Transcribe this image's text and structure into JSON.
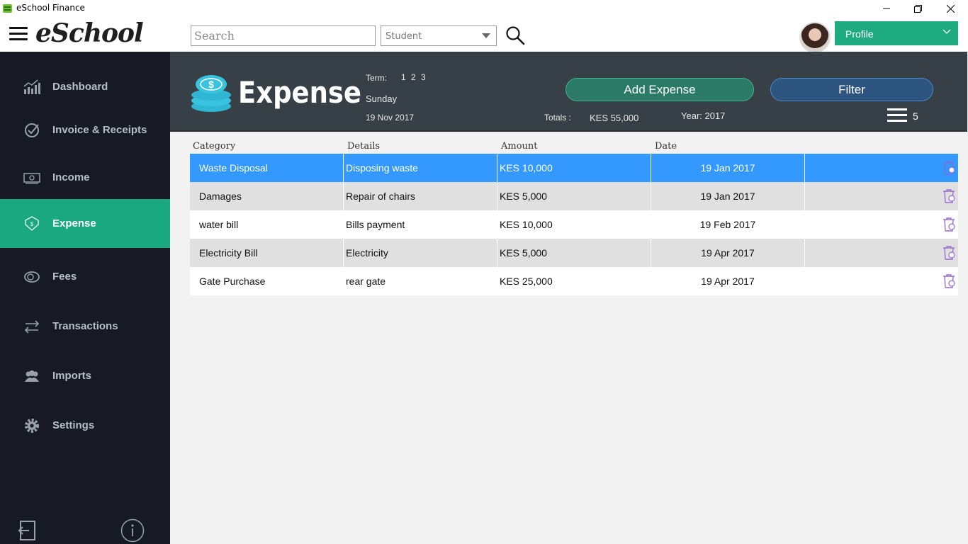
{
  "window": {
    "title": "eSchool Finance"
  },
  "topbar": {
    "brand": "eSchool",
    "search_placeholder": "Search",
    "student_select": "Student",
    "profile_label": "Profile"
  },
  "sidebar": {
    "items": [
      {
        "label": "Dashboard",
        "icon": "chart-icon"
      },
      {
        "label": "Invoice & Receipts",
        "icon": "check-circle-icon"
      },
      {
        "label": "Income",
        "icon": "banknote-icon"
      },
      {
        "label": "Expense",
        "icon": "money-hand-icon",
        "active": true
      },
      {
        "label": "Fees",
        "icon": "coins-icon"
      },
      {
        "label": "Transactions",
        "icon": "transfer-icon"
      },
      {
        "label": "Imports",
        "icon": "users-icon"
      },
      {
        "label": "Settings",
        "icon": "gear-icon"
      }
    ]
  },
  "header": {
    "title": "Expense",
    "term_label": "Term:",
    "terms": "1 2 3",
    "day": "Sunday",
    "date": "19 Nov 2017",
    "totals_label": "Totals :",
    "totals_value": "KES 55,000",
    "year_label": "Year: 2017",
    "add_expense_label": "Add Expense",
    "filter_label": "Filter",
    "count": "5"
  },
  "table": {
    "columns": [
      "Category",
      "Details",
      "Amount",
      "Date"
    ],
    "rows": [
      {
        "category": "Waste Disposal",
        "details": "Disposing waste",
        "amount": "KES 10,000",
        "date": "19 Jan 2017"
      },
      {
        "category": "Damages",
        "details": "Repair of chairs",
        "amount": "KES 5,000",
        "date": "19 Jan 2017"
      },
      {
        "category": "water bill",
        "details": "Bills payment",
        "amount": "KES 10,000",
        "date": "19 Feb 2017"
      },
      {
        "category": "Electricity Bill",
        "details": "Electricity",
        "amount": "KES 5,000",
        "date": "19 Apr 2017"
      },
      {
        "category": "Gate Purchase",
        "details": "rear gate",
        "amount": "KES 25,000",
        "date": "19 Apr 2017"
      }
    ]
  },
  "colors": {
    "accent": "#1aa97f",
    "sidebar_bg": "#171a24",
    "header_bg": "#373f47",
    "selected_row": "#3399ff"
  }
}
